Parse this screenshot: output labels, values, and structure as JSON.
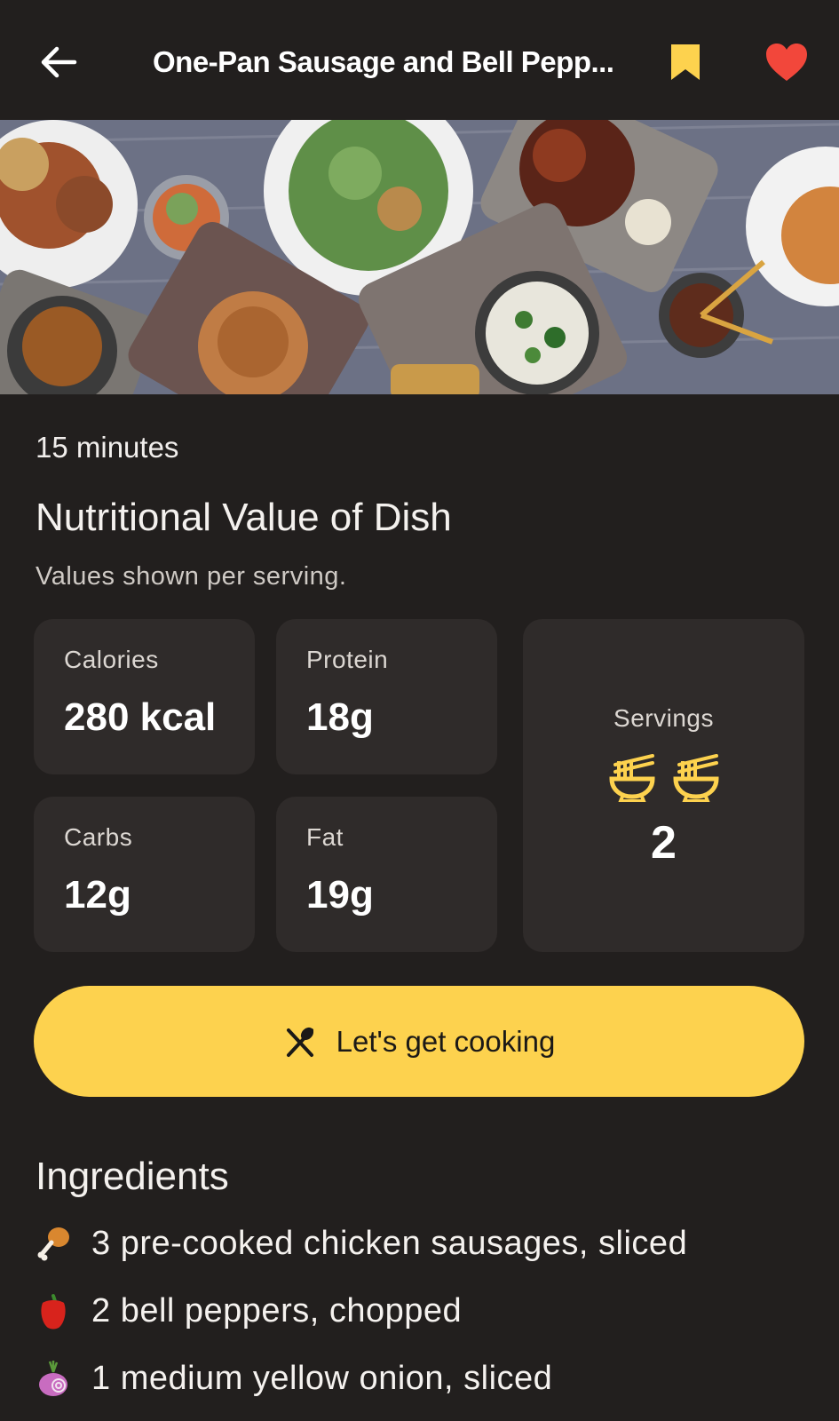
{
  "header": {
    "title": "One-Pan Sausage and Bell Pepp...",
    "icons": {
      "back": "arrow-left-icon",
      "bookmark": "bookmark-icon",
      "favorite": "heart-icon"
    },
    "colors": {
      "bookmark": "#fdd24e",
      "favorite": "#f2473b"
    }
  },
  "hero": {
    "image": "food-spread-photo"
  },
  "recipe": {
    "time": "15 minutes",
    "nutrition_title": "Nutritional Value of Dish",
    "nutrition_note": "Values shown per serving.",
    "calories": {
      "label": "Calories",
      "value": "280 kcal"
    },
    "protein": {
      "label": "Protein",
      "value": "18g"
    },
    "carbs": {
      "label": "Carbs",
      "value": "12g"
    },
    "fat": {
      "label": "Fat",
      "value": "19g"
    },
    "servings": {
      "label": "Servings",
      "value": "2",
      "icon": "noodle-bowl-icon"
    }
  },
  "cta": {
    "label": "Let's get cooking",
    "icon": "utensils-crossed-icon",
    "color": "#fdd24e"
  },
  "ingredients": {
    "title": "Ingredients",
    "items": [
      {
        "text": "3 pre-cooked chicken sausages, sliced",
        "icon": "chicken-leg-icon"
      },
      {
        "text": "2 bell peppers, chopped",
        "icon": "bell-pepper-icon"
      },
      {
        "text": "1 medium yellow onion, sliced",
        "icon": "onion-icon"
      }
    ]
  }
}
